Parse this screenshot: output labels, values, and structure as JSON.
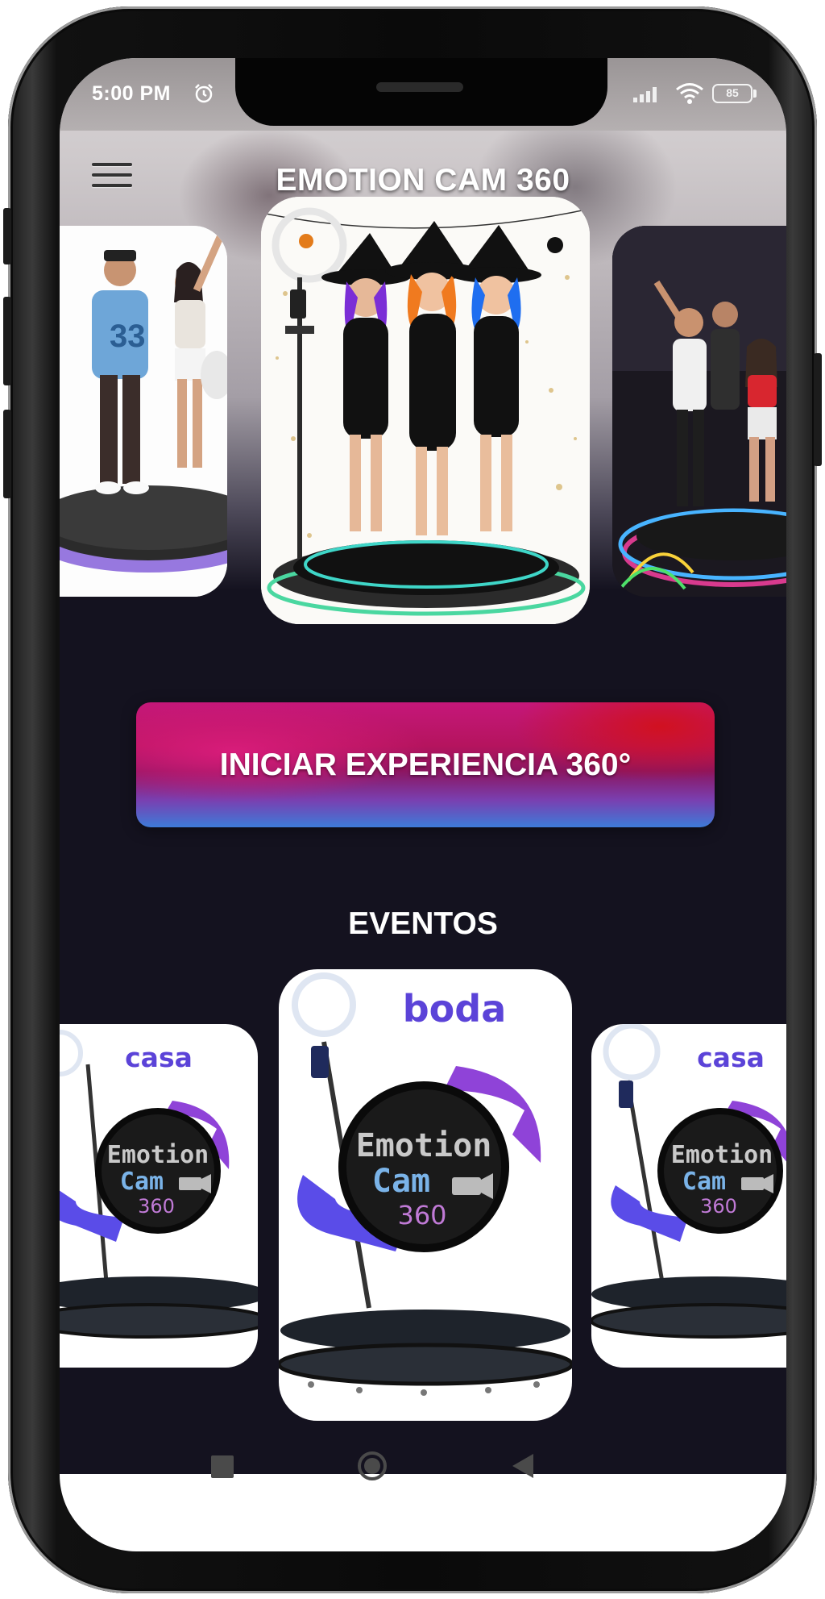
{
  "status_bar": {
    "time": "5:00 PM",
    "battery": "85",
    "icons": [
      "alarm-icon",
      "signal-icon",
      "wifi-icon",
      "battery-icon"
    ]
  },
  "header": {
    "title": "EMOTION CAM 360",
    "menu_icon": "hamburger-menu-icon"
  },
  "hero_carousel": {
    "slides": [
      {
        "name": "photo-couple-360-platform"
      },
      {
        "name": "photo-witches-360-platform"
      },
      {
        "name": "photo-party-360-platform"
      }
    ]
  },
  "cta": {
    "label": "INICIAR EXPERIENCIA 360°"
  },
  "events": {
    "title": "EVENTOS",
    "items": [
      {
        "label": "casa",
        "logo_line1": "Emotion",
        "logo_line2": "Cam",
        "logo_line3": "360"
      },
      {
        "label": "boda",
        "logo_line1": "Emotion",
        "logo_line2": "Cam",
        "logo_line3": "360"
      },
      {
        "label": "casa",
        "logo_line1": "Emotion",
        "logo_line2": "Cam",
        "logo_line3": "360"
      }
    ]
  },
  "nav_bar": {
    "icons": [
      "recent-apps-icon",
      "home-icon",
      "back-icon"
    ]
  },
  "colors": {
    "background": "#14121f",
    "accent": "#5b43d8",
    "cta_pink": "#c5177a",
    "cta_blue": "#3d7bd8"
  }
}
